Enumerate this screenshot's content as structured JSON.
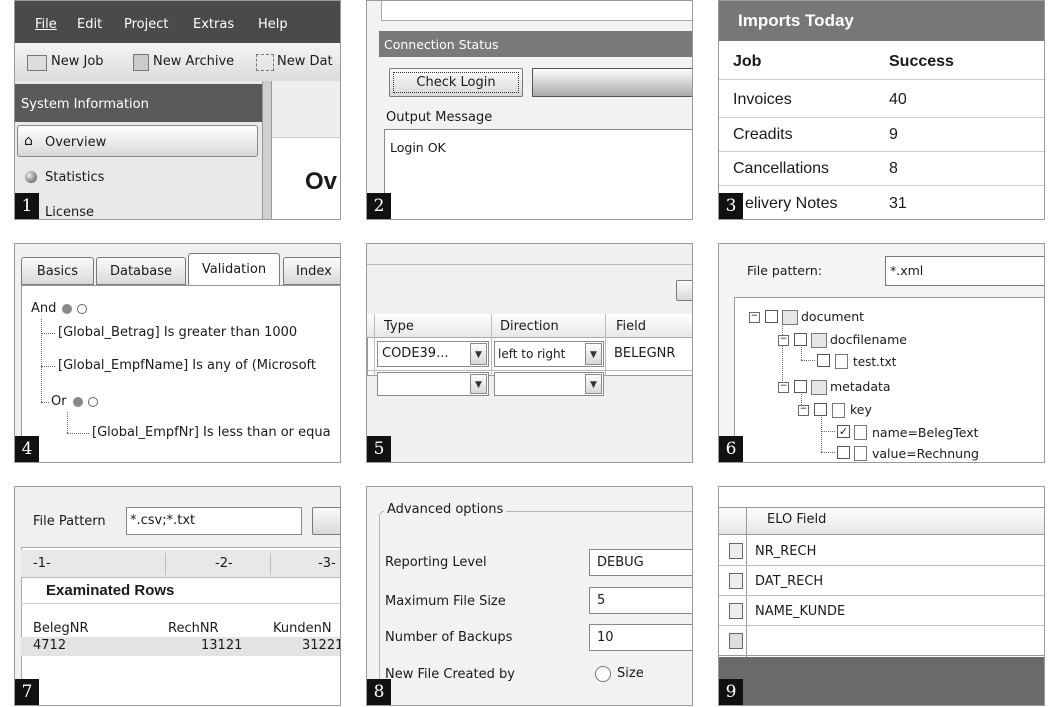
{
  "badges": [
    "1",
    "2",
    "3",
    "4",
    "5",
    "6",
    "7",
    "8",
    "9"
  ],
  "p1": {
    "menu": [
      "File",
      "Edit",
      "Project",
      "Extras",
      "Help"
    ],
    "toolbar": [
      "New Job",
      "New Archive",
      "New Dat"
    ],
    "section_title": "System Information",
    "nav": [
      "Overview",
      "Statistics",
      "License"
    ],
    "heading_fragment": "Ov"
  },
  "p2": {
    "group_title": "Connection Status",
    "check_login": "Check Login",
    "output_label": "Output Message",
    "output_text": "Login OK"
  },
  "p3": {
    "title": "Imports Today",
    "headers": [
      "Job",
      "Success"
    ],
    "rows": [
      {
        "job": "Invoices",
        "success": "40"
      },
      {
        "job": "Creadits",
        "success": "9"
      },
      {
        "job": "Cancellations",
        "success": "8"
      },
      {
        "job": "elivery Notes",
        "success": "31"
      }
    ]
  },
  "p4": {
    "tabs": [
      "Basics",
      "Database",
      "Validation",
      "Index"
    ],
    "and_label": "And",
    "rules": [
      "[Global_Betrag] Is greater than 1000",
      "[Global_EmpfName] Is any of (Microsoft",
      "[Global_EmpfNr] Is less than or equa"
    ],
    "or_label": "Or"
  },
  "p5": {
    "headers": [
      "Type",
      "Direction",
      "Field"
    ],
    "type_value": "CODE39...",
    "direction_value": "left to right",
    "field_value": "BELEGNR"
  },
  "p6": {
    "label": "File pattern:",
    "value": "*.xml",
    "tree": [
      "document",
      "docfilename",
      "test.txt",
      "metadata",
      "key",
      "name=BelegText",
      "value=Rechnung"
    ]
  },
  "p7": {
    "label": "File Pattern",
    "value": "*.csv;*.txt",
    "cols": [
      "-1-",
      "-2-",
      "-3-"
    ],
    "section": "Examinated Rows",
    "headers": [
      "BelegNR",
      "RechNR",
      "KundenN"
    ],
    "values": [
      "4712",
      "13121",
      "31221"
    ]
  },
  "p8": {
    "group": "Advanced options",
    "labels": [
      "Reporting Level",
      "Maximum File Size",
      "Number of Backups",
      "New File Created by"
    ],
    "values": [
      "DEBUG",
      "5",
      "10"
    ],
    "radio_label": "Size"
  },
  "p9": {
    "header": "ELO Field",
    "rows": [
      "NR_RECH",
      "DAT_RECH",
      "NAME_KUNDE"
    ]
  }
}
